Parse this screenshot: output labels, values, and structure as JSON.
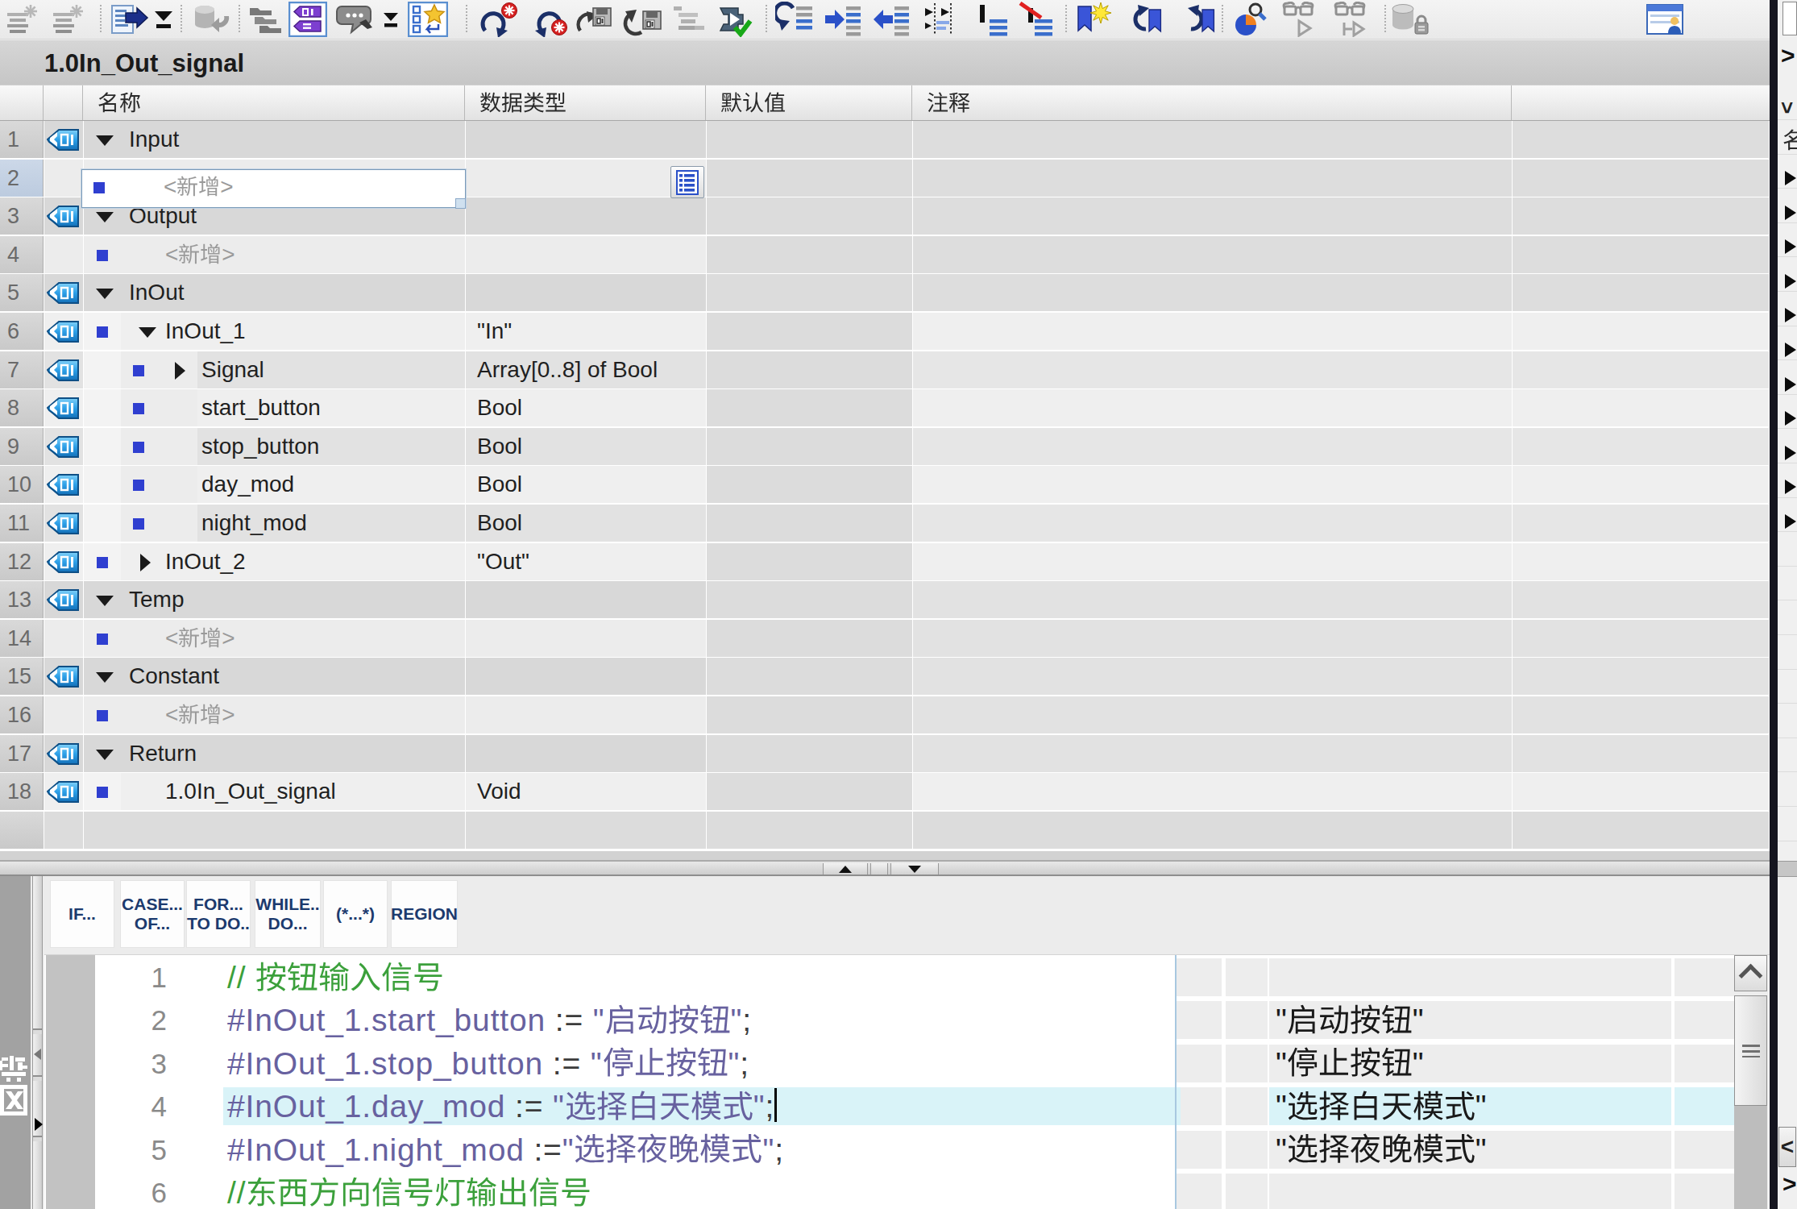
{
  "window": {
    "title": "1.0In_Out_signal"
  },
  "toolbar": {
    "icons": [
      "compile-icon",
      "compile-all-icon",
      "add-row-icon",
      "add-row-menu-icon",
      "upload-icon",
      "network-overview-icon",
      "absolute-operands-toggle-icon",
      "comments-icon",
      "comments-menu-icon",
      "favorites-toggle-icon",
      "previous-error-icon",
      "next-error-icon",
      "update-block-call-icon",
      "sync-block-call-icon",
      "structure-icon",
      "consistency-check-icon",
      "goto-definition-icon",
      "indent-icon",
      "outdent-icon",
      "format-icon",
      "mark-line-icon",
      "clear-format-icon",
      "add-bookmark-icon",
      "previous-bookmark-icon",
      "next-bookmark-icon",
      "find-replace-icon",
      "monitor-icon",
      "monitor-stop-icon",
      "know-how-protection-icon",
      "window-split-icon"
    ]
  },
  "interface_table": {
    "columns": [
      "名称",
      "数据类型",
      "默认值",
      "注释"
    ],
    "rows": [
      {
        "num": "1",
        "name": "Input",
        "type": "",
        "expanded": true,
        "kind": "section"
      },
      {
        "num": "2",
        "name": "<新增>",
        "type": "",
        "kind": "add-new",
        "editing": true
      },
      {
        "num": "3",
        "name": "Output",
        "type": "",
        "expanded": true,
        "kind": "section"
      },
      {
        "num": "4",
        "name": "<新增>",
        "type": "",
        "kind": "add-new"
      },
      {
        "num": "5",
        "name": "InOut",
        "type": "",
        "expanded": true,
        "kind": "section"
      },
      {
        "num": "6",
        "name": "InOut_1",
        "type": "\"In\"",
        "expanded": true,
        "kind": "var-struct"
      },
      {
        "num": "7",
        "name": "Signal",
        "type": "Array[0..8] of Bool",
        "expanded": false,
        "kind": "var-child"
      },
      {
        "num": "8",
        "name": "start_button",
        "type": "Bool",
        "kind": "var-child"
      },
      {
        "num": "9",
        "name": "stop_button",
        "type": "Bool",
        "kind": "var-child"
      },
      {
        "num": "10",
        "name": "day_mod",
        "type": "Bool",
        "kind": "var-child"
      },
      {
        "num": "11",
        "name": "night_mod",
        "type": "Bool",
        "kind": "var-child"
      },
      {
        "num": "12",
        "name": "InOut_2",
        "type": "\"Out\"",
        "expanded": false,
        "kind": "var-struct"
      },
      {
        "num": "13",
        "name": "Temp",
        "type": "",
        "expanded": true,
        "kind": "section"
      },
      {
        "num": "14",
        "name": "<新增>",
        "type": "",
        "kind": "add-new"
      },
      {
        "num": "15",
        "name": "Constant",
        "type": "",
        "expanded": true,
        "kind": "section"
      },
      {
        "num": "16",
        "name": "<新增>",
        "type": "",
        "kind": "add-new"
      },
      {
        "num": "17",
        "name": "Return",
        "type": "",
        "expanded": true,
        "kind": "section"
      },
      {
        "num": "18",
        "name": "1.0In_Out_signal",
        "type": "Void",
        "kind": "var"
      }
    ]
  },
  "splitter": {
    "collapse_up_icon": "collapse-up-icon",
    "collapse_down_icon": "collapse-down-icon"
  },
  "snippet_bar": {
    "buttons": [
      "IF...",
      "CASE...\nOF...",
      "FOR...\nTO DO..",
      "WHILE..\nDO...",
      "(*...*)",
      "REGION"
    ]
  },
  "code_editor": {
    "lines": [
      {
        "num": "1",
        "text": "// 按钮输入信号",
        "kind": "comment",
        "operand": ""
      },
      {
        "num": "2",
        "text": "#InOut_1.start_button := \"启动按钮\";",
        "kind": "statement",
        "operand": "\"启动按钮\""
      },
      {
        "num": "3",
        "text": "#InOut_1.stop_button := \"停止按钮\";",
        "kind": "statement",
        "operand": "\"停止按钮\""
      },
      {
        "num": "4",
        "text": "#InOut_1.day_mod := \"选择白天模式\";",
        "kind": "statement",
        "operand": "\"选择白天模式\"",
        "current": true
      },
      {
        "num": "5",
        "text": "#InOut_1.night_mod :=\"选择夜晚模式\";",
        "kind": "statement",
        "operand": "\"选择夜晚模式\""
      },
      {
        "num": "6",
        "text": "//东西方向信号灯输出信号",
        "kind": "comment",
        "operand": ""
      }
    ]
  },
  "left_panel": {
    "icons": [
      "device-status-icon",
      "error-box-icon"
    ]
  },
  "right_panel": {
    "header_partial": "名",
    "tree_expand_arrows": 11
  },
  "colors": {
    "accent_blue": "#2f6fc4",
    "tag_icon_blue": "#2da0e8",
    "comment_green": "#3ba03b",
    "identifier_purple": "#67619f",
    "selection_cyan": "#dbf4f9",
    "section_row_gray": "#d9d9d9"
  }
}
